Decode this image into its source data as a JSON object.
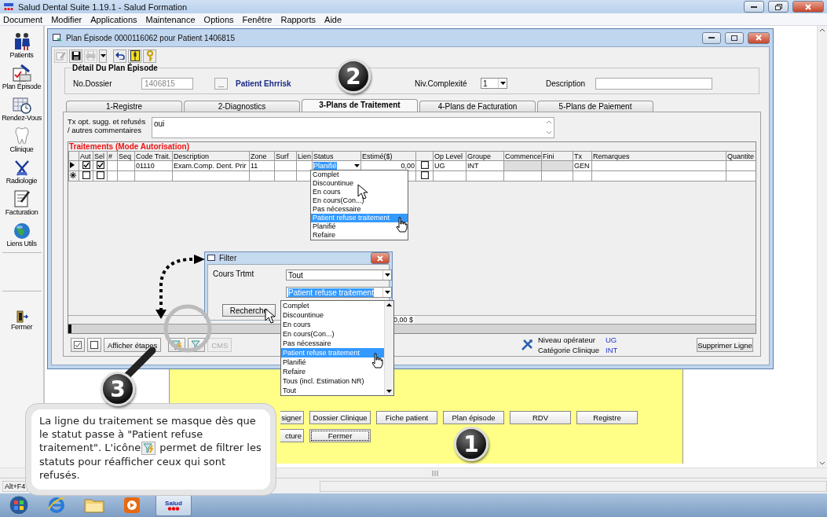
{
  "app": {
    "title": "Salud Dental Suite 1.19.1 - Salud Formation"
  },
  "menu": [
    "Document",
    "Modifier",
    "Applications",
    "Maintenance",
    "Options",
    "Fenêtre",
    "Rapports",
    "Aide"
  ],
  "sidebar": [
    {
      "kind": "patients",
      "label": "Patients"
    },
    {
      "kind": "plan",
      "label": "Plan Épisode"
    },
    {
      "kind": "calendar",
      "label": "Rendez-Vous"
    },
    {
      "kind": "tooth",
      "label": "Clinique"
    },
    {
      "kind": "xray",
      "label": "Radiologie"
    },
    {
      "kind": "billing",
      "label": "Facturation"
    },
    {
      "kind": "globe",
      "label": "Liens Utils"
    },
    {
      "kind": "exit",
      "label": "Fermer"
    }
  ],
  "window": {
    "title": "Plan Épisode 0000116062 pour Patient 1406815"
  },
  "toolbar": [
    {
      "kind": "edit",
      "disabled": true
    },
    {
      "kind": "save",
      "disabled": false
    },
    {
      "kind": "print",
      "disabled": true
    },
    {
      "kind": "caret",
      "disabled": false
    },
    {
      "kind": "undo",
      "disabled": false
    },
    {
      "kind": "book",
      "disabled": false
    },
    {
      "kind": "key",
      "disabled": false
    }
  ],
  "detail": {
    "title": "Détail Du Plan Épisode",
    "dossier_label": "No.Dossier",
    "dossier_value": "1406815",
    "browse_button": "...",
    "patient_name": "Patient Ehrrisk",
    "complexity_label": "Niv.Complexité",
    "complexity_value": "1",
    "description_label": "Description"
  },
  "tabs": [
    {
      "label": "1-Registre",
      "selected": false
    },
    {
      "label": "2-Diagnostics",
      "selected": false
    },
    {
      "label": "3-Plans de Traitement",
      "selected": true
    },
    {
      "label": "4-Plans de Facturation",
      "selected": false
    },
    {
      "label": "5-Plans de Paiement",
      "selected": false
    }
  ],
  "comments": {
    "label": "Tx opt. sugg. et refusés / autres commentaires",
    "value": "oui"
  },
  "treatments": {
    "title": "Traitements (Mode Autorisation)",
    "columns": [
      {
        "kind": "check",
        "label": "Aut"
      },
      {
        "kind": "check",
        "label": "Sel"
      },
      {
        "kind": "text",
        "label": "#"
      },
      {
        "kind": "text",
        "label": "Seq"
      },
      {
        "kind": "text",
        "label": "Code Trait."
      },
      {
        "kind": "text",
        "label": "Description"
      },
      {
        "kind": "text",
        "label": "Zone"
      },
      {
        "kind": "text",
        "label": "Surf"
      },
      {
        "kind": "text",
        "label": "Lien"
      },
      {
        "kind": "dropdown",
        "label": "Status"
      },
      {
        "kind": "number",
        "label": "Estimé($)"
      },
      {
        "kind": "check"
      },
      {
        "kind": "text",
        "label": "Op Level"
      },
      {
        "kind": "text",
        "label": "Groupe"
      },
      {
        "kind": "text",
        "label": "Commence"
      },
      {
        "kind": "text",
        "label": "Fini"
      },
      {
        "kind": "text",
        "label": "Tx"
      },
      {
        "kind": "text",
        "label": "Remarques"
      },
      {
        "kind": "text",
        "label": "Quantite"
      }
    ],
    "rows": [
      {
        "kind": "current",
        "cells": [
          {
            "checked": true
          },
          {
            "checked": true
          },
          {},
          {},
          {
            "text": "01110"
          },
          {
            "text": "Exam.Comp. Dent. Prir"
          },
          {
            "text": "11"
          },
          {},
          {},
          {
            "text": "Planifié",
            "selected": true
          },
          {
            "text": "0,00"
          },
          {
            "checked": false
          },
          {
            "text": "UG"
          },
          {
            "text": "INT"
          },
          {
            "disabled": true
          },
          {
            "disabled": true
          },
          {
            "text": "GEN"
          },
          {},
          {}
        ]
      },
      {
        "kind": "new",
        "cells": [
          {
            "checked": false
          },
          {
            "checked": false
          },
          {},
          {},
          {},
          {},
          {},
          {},
          {},
          {},
          {},
          {
            "checked": false
          },
          {},
          {},
          {},
          {},
          {},
          {},
          {}
        ]
      }
    ],
    "total": "0,00 $"
  },
  "status_options": [
    {
      "label": "Complet",
      "selected": false
    },
    {
      "label": "Discountinue",
      "selected": false
    },
    {
      "label": "En cours",
      "selected": false
    },
    {
      "label": "En cours(Con...)",
      "selected": false
    },
    {
      "label": "Pas nécessaire",
      "selected": false
    },
    {
      "label": "Patient refuse traitement",
      "selected": true
    },
    {
      "label": "Planifié",
      "selected": false
    },
    {
      "label": "Refaire",
      "selected": false
    }
  ],
  "bottom_buttons": [
    {
      "kind": "check-all",
      "disabled": false
    },
    {
      "kind": "uncheck-all",
      "disabled": false
    },
    {
      "kind": "text",
      "label": "Afficher étapes",
      "disabled": false
    },
    {
      "kind": "filter-lightning",
      "disabled": false
    },
    {
      "kind": "filter",
      "disabled": false
    },
    {
      "kind": "text",
      "label": "CMS",
      "disabled": true
    }
  ],
  "info": [
    {
      "label": "Niveau opérateur",
      "value": "UG"
    },
    {
      "label": "Catégorie Clinique",
      "value": "INT"
    }
  ],
  "delete_button": "Supprimer Ligne",
  "filter": {
    "title": "Filter",
    "field_label": "Cours Trtmt",
    "course_value": "Tout",
    "status_value": "Patient refuse traitement",
    "search_button": "Recherche",
    "options": [
      {
        "label": "Complet",
        "selected": false
      },
      {
        "label": "Discountinue",
        "selected": false
      },
      {
        "label": "En cours",
        "selected": false
      },
      {
        "label": "En cours(Con...)",
        "selected": false
      },
      {
        "label": "Pas nécessaire",
        "selected": false
      },
      {
        "label": "Patient refuse traitement",
        "selected": true
      },
      {
        "label": "Planifié",
        "selected": false
      },
      {
        "label": "Refaire",
        "selected": false
      },
      {
        "label": "Tous (incl. Estimation NR)",
        "selected": false
      },
      {
        "label": "Tout",
        "selected": false
      }
    ]
  },
  "panel_buttons": [
    [
      {
        "label": "signer",
        "focused": false
      },
      {
        "label": "Dossier Clinique",
        "focused": false
      },
      {
        "label": "Fiche patient",
        "focused": false
      },
      {
        "label": "Plan épisode",
        "focused": false
      },
      {
        "label": "RDV",
        "focused": false
      },
      {
        "label": "Registre",
        "focused": false
      }
    ],
    [
      {
        "label": "cture",
        "focused": false
      },
      {
        "label": "Fermer",
        "focused": true
      }
    ]
  ],
  "callout": {
    "text_before": "La ligne du traitement se masque dès que le statut passe à \"Patient refuse traitement\". L'icône",
    "text_after": "permet de filtrer les statuts pour réafficher ceux qui sont refusés."
  },
  "badges": [
    "1",
    "2",
    "3"
  ],
  "status_bar": {
    "text": "Alt+F4"
  },
  "taskbar": [
    {
      "kind": "start"
    },
    {
      "kind": "browser"
    },
    {
      "kind": "folder"
    },
    {
      "kind": "media"
    },
    {
      "kind": "salud",
      "label": "Salud"
    }
  ]
}
